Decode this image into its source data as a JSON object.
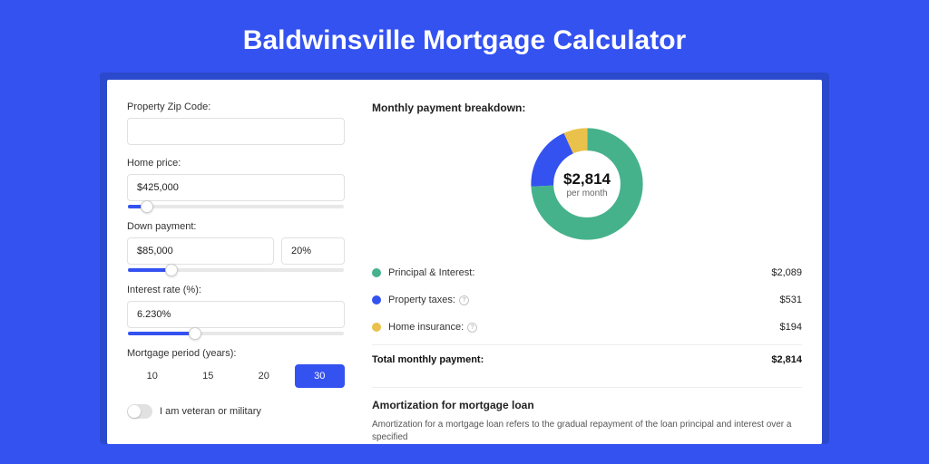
{
  "title": "Baldwinsville Mortgage Calculator",
  "form": {
    "zip_label": "Property Zip Code:",
    "zip_value": "",
    "price_label": "Home price:",
    "price_value": "$425,000",
    "price_slider_pct": 9,
    "down_label": "Down payment:",
    "down_value": "$85,000",
    "down_pct_value": "20%",
    "down_slider_pct": 20,
    "rate_label": "Interest rate (%):",
    "rate_value": "6.230%",
    "rate_slider_pct": 31,
    "period_label": "Mortgage period (years):",
    "periods": [
      "10",
      "15",
      "20",
      "30"
    ],
    "period_active": 3,
    "veteran_label": "I am veteran or military"
  },
  "breakdown": {
    "title": "Monthly payment breakdown:",
    "center_amount": "$2,814",
    "center_sub": "per month",
    "rows": [
      {
        "label": "Principal & Interest:",
        "value": "$2,089",
        "color": "#46b28c",
        "info": false
      },
      {
        "label": "Property taxes:",
        "value": "$531",
        "color": "#3452f0",
        "info": true
      },
      {
        "label": "Home insurance:",
        "value": "$194",
        "color": "#eac14a",
        "info": true
      }
    ],
    "total_label": "Total monthly payment:",
    "total_value": "$2,814"
  },
  "amort": {
    "title": "Amortization for mortgage loan",
    "text": "Amortization for a mortgage loan refers to the gradual repayment of the loan principal and interest over a specified"
  },
  "chart_data": {
    "type": "pie",
    "title": "Monthly payment breakdown",
    "series": [
      {
        "name": "Principal & Interest",
        "value": 2089,
        "color": "#46b28c"
      },
      {
        "name": "Property taxes",
        "value": 531,
        "color": "#3452f0"
      },
      {
        "name": "Home insurance",
        "value": 194,
        "color": "#eac14a"
      }
    ],
    "total": 2814,
    "center_label": "$2,814 per month",
    "donut": true
  }
}
